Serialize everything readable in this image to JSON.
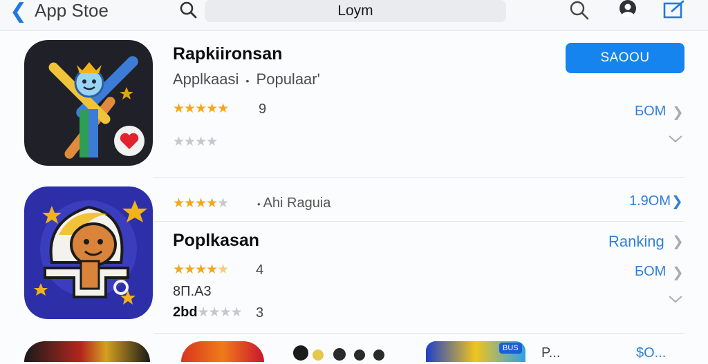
{
  "nav": {
    "back_glyph": "❮",
    "title": "App Stoe",
    "search_value": "Loym",
    "accent": "#1f7ae0"
  },
  "apps": [
    {
      "title": "Rapkiironsan",
      "category": "Applkaasi",
      "separator": "•",
      "tag": "Populaar",
      "tag_suffix": "'",
      "rating_count": "9",
      "get_label": "SAOOU",
      "size": "ƂOM",
      "icon": "game-stick-figure-icon"
    },
    {
      "review_author": "Ahi Raguia",
      "review_separator": "•",
      "review_count": "1.9OM",
      "title": "Poplkasan",
      "ranking_label": "Ranking",
      "rating_count": "4",
      "size": "ƂOM",
      "extra_line": "8Π.A3",
      "bottom_prefix": "2bd",
      "bottom_count": "3",
      "icon": "monkey-character-icon"
    }
  ],
  "partial_row": {
    "badge": "BUS",
    "label": "Ρ...",
    "price": "$O..."
  },
  "colors": {
    "star_gold": "#f2a81a",
    "star_grey": "#c6c8cc",
    "button_blue": "#1684ef",
    "link_blue": "#2f7fd8"
  }
}
